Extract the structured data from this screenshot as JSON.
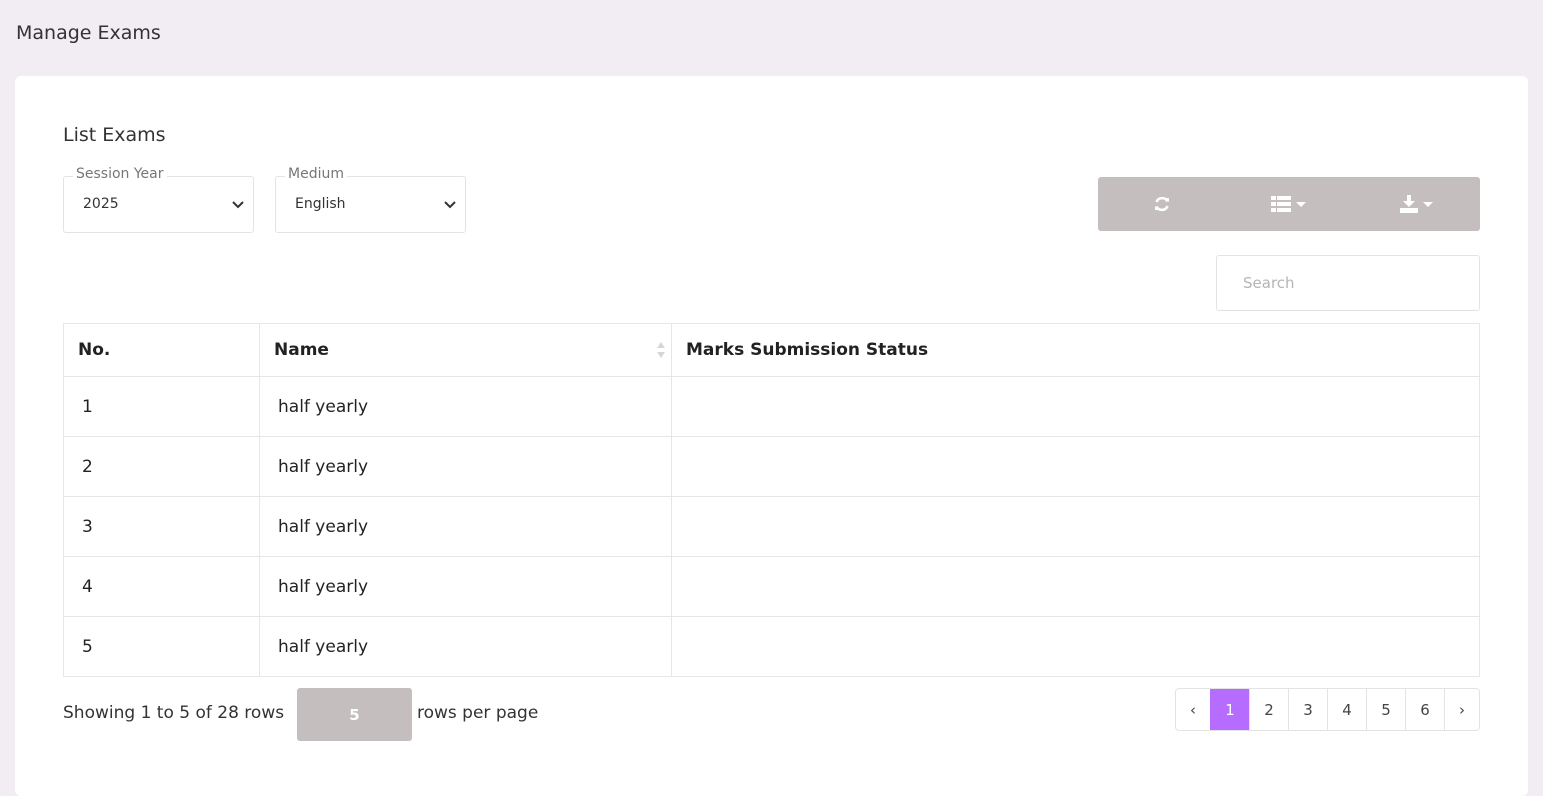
{
  "page": {
    "title": "Manage Exams"
  },
  "card": {
    "title": "List Exams"
  },
  "filters": {
    "session_year": {
      "label": "Session Year",
      "value": "2025"
    },
    "medium": {
      "label": "Medium",
      "value": "English"
    }
  },
  "toolbar": {
    "refresh_icon": "refresh-icon",
    "columns_icon": "list-columns-icon",
    "export_icon": "download-icon",
    "color": "#c4bebe"
  },
  "search": {
    "placeholder": "Search"
  },
  "table": {
    "headers": [
      "No.",
      "Name",
      "Marks Submission Status"
    ],
    "rows": [
      {
        "no": "1",
        "name": "half yearly",
        "status": ""
      },
      {
        "no": "2",
        "name": "half yearly",
        "status": ""
      },
      {
        "no": "3",
        "name": "half yearly",
        "status": ""
      },
      {
        "no": "4",
        "name": "half yearly",
        "status": ""
      },
      {
        "no": "5",
        "name": "half yearly",
        "status": ""
      }
    ]
  },
  "footer": {
    "showing": "Showing 1 to 5 of 28 rows",
    "page_size": "5",
    "rows_per_page": "rows per page"
  },
  "pagination": {
    "prev": "‹",
    "pages": [
      "1",
      "2",
      "3",
      "4",
      "5",
      "6"
    ],
    "active": "1",
    "next": "›",
    "accent": "#b66dff"
  }
}
